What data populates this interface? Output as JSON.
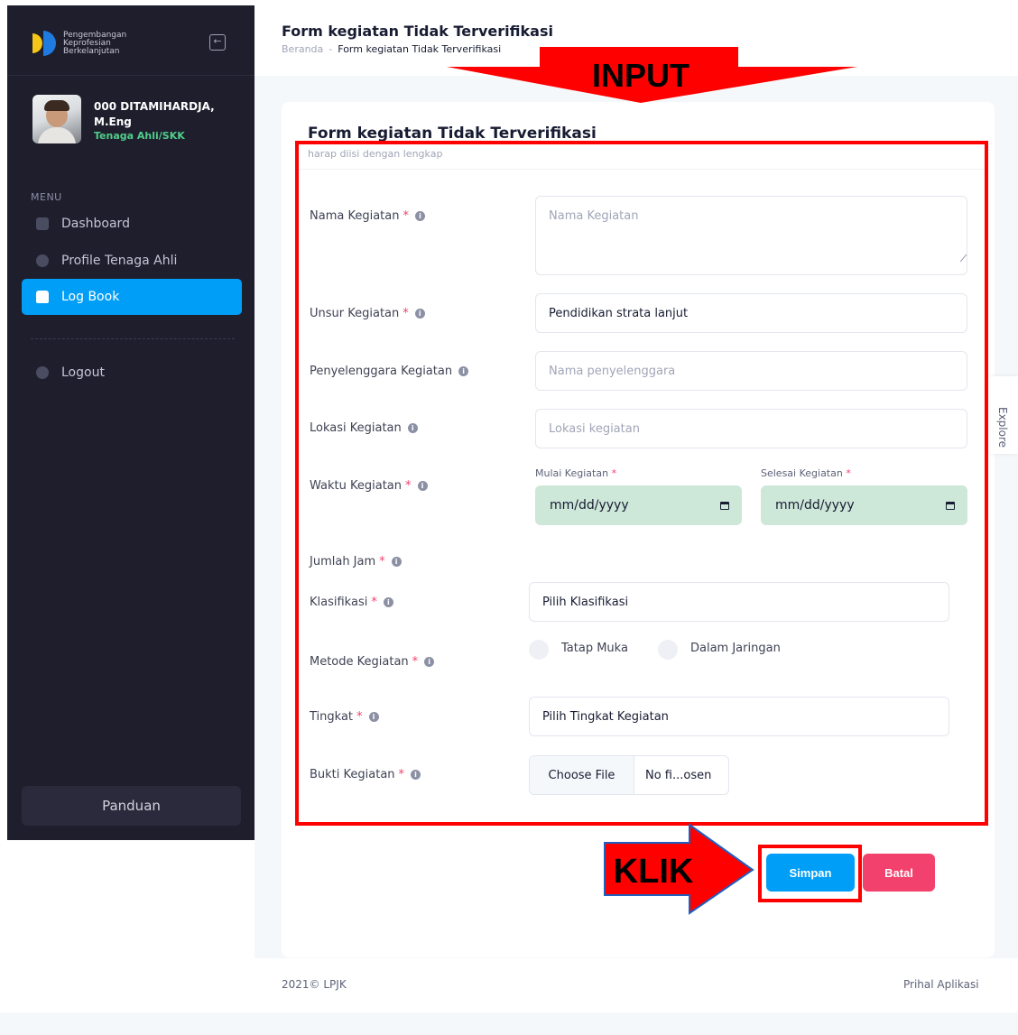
{
  "sidebar": {
    "logo_lines": [
      "Pengembangan",
      "Keprofesian",
      "Berkelanjutan"
    ],
    "user": {
      "name_line1": "000 DITAMIHARDJA,",
      "name_line2": "M.Eng",
      "role": "Tenaga Ahli/SKK"
    },
    "menu_heading": "MENU",
    "items": [
      {
        "label": "Dashboard",
        "icon": "grid-icon"
      },
      {
        "label": "Profile Tenaga Ahli",
        "icon": "user-icon"
      },
      {
        "label": "Log Book",
        "icon": "briefcase-icon",
        "active": true
      },
      {
        "label": "Logout",
        "icon": "logout-icon"
      }
    ],
    "panduan_label": "Panduan"
  },
  "header": {
    "title": "Form kegiatan Tidak Terverifikasi",
    "breadcrumb": {
      "home": "Beranda",
      "separator": "-",
      "current": "Form kegiatan Tidak Terverifikasi"
    }
  },
  "form": {
    "title": "Form kegiatan Tidak Terverifikasi",
    "subtitle": "harap diisi dengan lengkap",
    "required_mark": "*",
    "nama": {
      "label": "Nama Kegiatan",
      "placeholder": "Nama Kegiatan"
    },
    "unsur": {
      "label": "Unsur Kegiatan",
      "value": "Pendidikan strata lanjut"
    },
    "penyelenggara": {
      "label": "Penyelenggara Kegiatan",
      "placeholder": "Nama penyelenggara"
    },
    "lokasi": {
      "label": "Lokasi Kegiatan",
      "placeholder": "Lokasi kegiatan"
    },
    "waktu": {
      "label": "Waktu Kegiatan",
      "mulai_label": "Mulai Kegiatan",
      "selesai_label": "Selesai Kegiatan",
      "date_placeholder": "mm/dd/yyyy"
    },
    "jumlah_jam": {
      "label": "Jumlah Jam"
    },
    "klasifikasi": {
      "label": "Klasifikasi",
      "value": "Pilih Klasifikasi"
    },
    "metode": {
      "label": "Metode Kegiatan",
      "options": [
        "Tatap Muka",
        "Dalam Jaringan"
      ]
    },
    "tingkat": {
      "label": "Tingkat",
      "value": "Pilih Tingkat Kegiatan"
    },
    "bukti": {
      "label": "Bukti Kegiatan",
      "choose_label": "Choose File",
      "file_status": "No fi...osen"
    },
    "save_label": "Simpan",
    "cancel_label": "Batal"
  },
  "explore_label": "Explore",
  "footer": {
    "copyright": "2021© LPJK",
    "link": "Prihal Aplikasi"
  },
  "annotations": {
    "input_label": "INPUT",
    "klik_label": "KLIK",
    "color": "#ff0000"
  },
  "colors": {
    "primary": "#009ef7",
    "danger": "#f1416c",
    "sidebar_bg": "#1e1e2d",
    "date_bg": "#cde7d8"
  }
}
